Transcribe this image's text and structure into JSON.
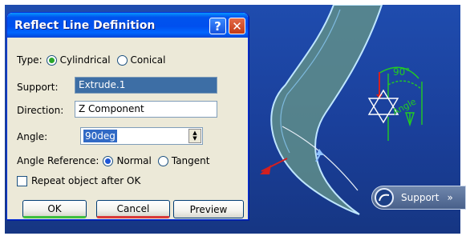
{
  "dialog": {
    "title": "Reflect Line Definition",
    "help_label": "?",
    "close_label": "✕",
    "type": {
      "label": "Type:",
      "options": [
        "Cylindrical",
        "Conical"
      ],
      "selected": "Cylindrical"
    },
    "support": {
      "label": "Support:",
      "value": "Extrude.1"
    },
    "direction": {
      "label": "Direction:",
      "value": "Z Component"
    },
    "angle": {
      "label": "Angle:",
      "value": "90deg"
    },
    "angle_reference": {
      "label": "Angle Reference:",
      "options": [
        "Normal",
        "Tangent"
      ],
      "selected": "Normal"
    },
    "repeat": {
      "label": "Repeat object after OK",
      "checked": false
    },
    "buttons": {
      "ok": "OK",
      "cancel": "Cancel",
      "preview": "Preview"
    }
  },
  "viewport": {
    "support_tag": {
      "label": "Support",
      "arrows": "»"
    },
    "annotations": {
      "angle_value": "90°",
      "angle_label": "Angle"
    }
  },
  "colors": {
    "viewport_bg": "#1f4cae",
    "titlebar": "#0053ee",
    "surface": "#5f8e8a",
    "surface_edge": "#bfe6ff",
    "ok_accent": "#3fbf3f",
    "cancel_accent": "#d83a3a",
    "manipulator": "#22cc22"
  }
}
